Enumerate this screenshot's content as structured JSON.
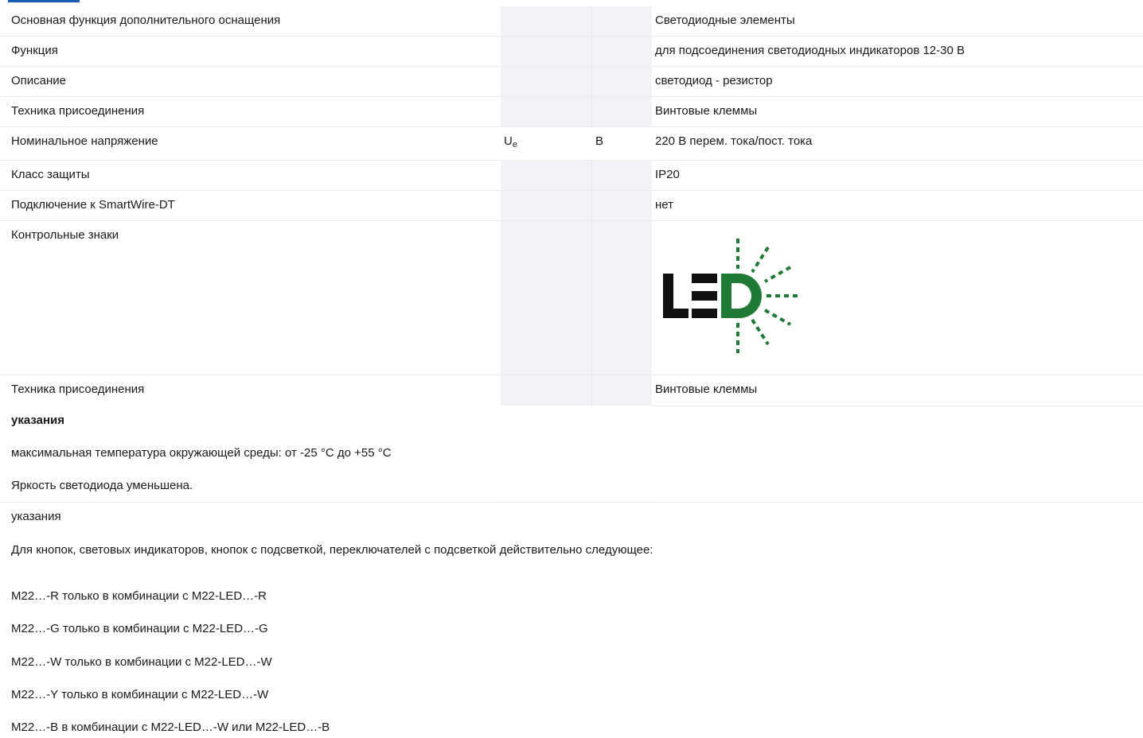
{
  "spec_rows": [
    {
      "label": "Основная функция дополнительного оснащения",
      "symbol": "",
      "unit": "",
      "value": "Светодиодные элементы"
    },
    {
      "label": "Функция",
      "symbol": "",
      "unit": "",
      "value": "для подсоединения светодиодных индикаторов 12-30 В"
    },
    {
      "label": "Описание",
      "symbol": "",
      "unit": "",
      "value": "светодиод - резистор"
    },
    {
      "label": "Техника присоединения",
      "symbol": "",
      "unit": "",
      "value": "Винтовые клеммы"
    },
    {
      "label": "Номинальное напряжение",
      "symbol": "U",
      "symbol_sub": "e",
      "unit": "В",
      "value": "220 В перем. тока/пост. тока"
    },
    {
      "label": "Класс защиты",
      "symbol": "",
      "unit": "",
      "value": "IP20"
    },
    {
      "label": "Подключение к SmartWire-DT",
      "symbol": "",
      "unit": "",
      "value": "нет"
    },
    {
      "label": "Контрольные знаки",
      "symbol": "",
      "unit": "",
      "value": "",
      "logo": "led-logo"
    },
    {
      "label": "Техника присоединения",
      "symbol": "",
      "unit": "",
      "value": "Винтовые клеммы"
    }
  ],
  "notes_1": {
    "title": "указания",
    "lines": [
      "максимальная температура окружающей среды: от -25 °C до +55 °C",
      "Яркость светодиода уменьшена."
    ]
  },
  "notes_2": {
    "title": "указания",
    "intro": "Для кнопок, световых индикаторов, кнопок с подсветкой, переключателей с подсветкой действительно следующее:",
    "lines": [
      "M22…-R только в комбинации с M22-LED…-R",
      "M22…-G только в комбинации с M22-LED…-G",
      "M22…-W только в комбинации с M22-LED…-W",
      "M22…-Y только в комбинации с M22-LED…-W",
      "M22…-B в комбинации с M22-LED…-W или M22-LED…-B"
    ]
  },
  "colors": {
    "accent": "#1a5fb4",
    "led_green": "#1f7a35",
    "led_black": "#111111",
    "shade": "#f1f3f6"
  }
}
